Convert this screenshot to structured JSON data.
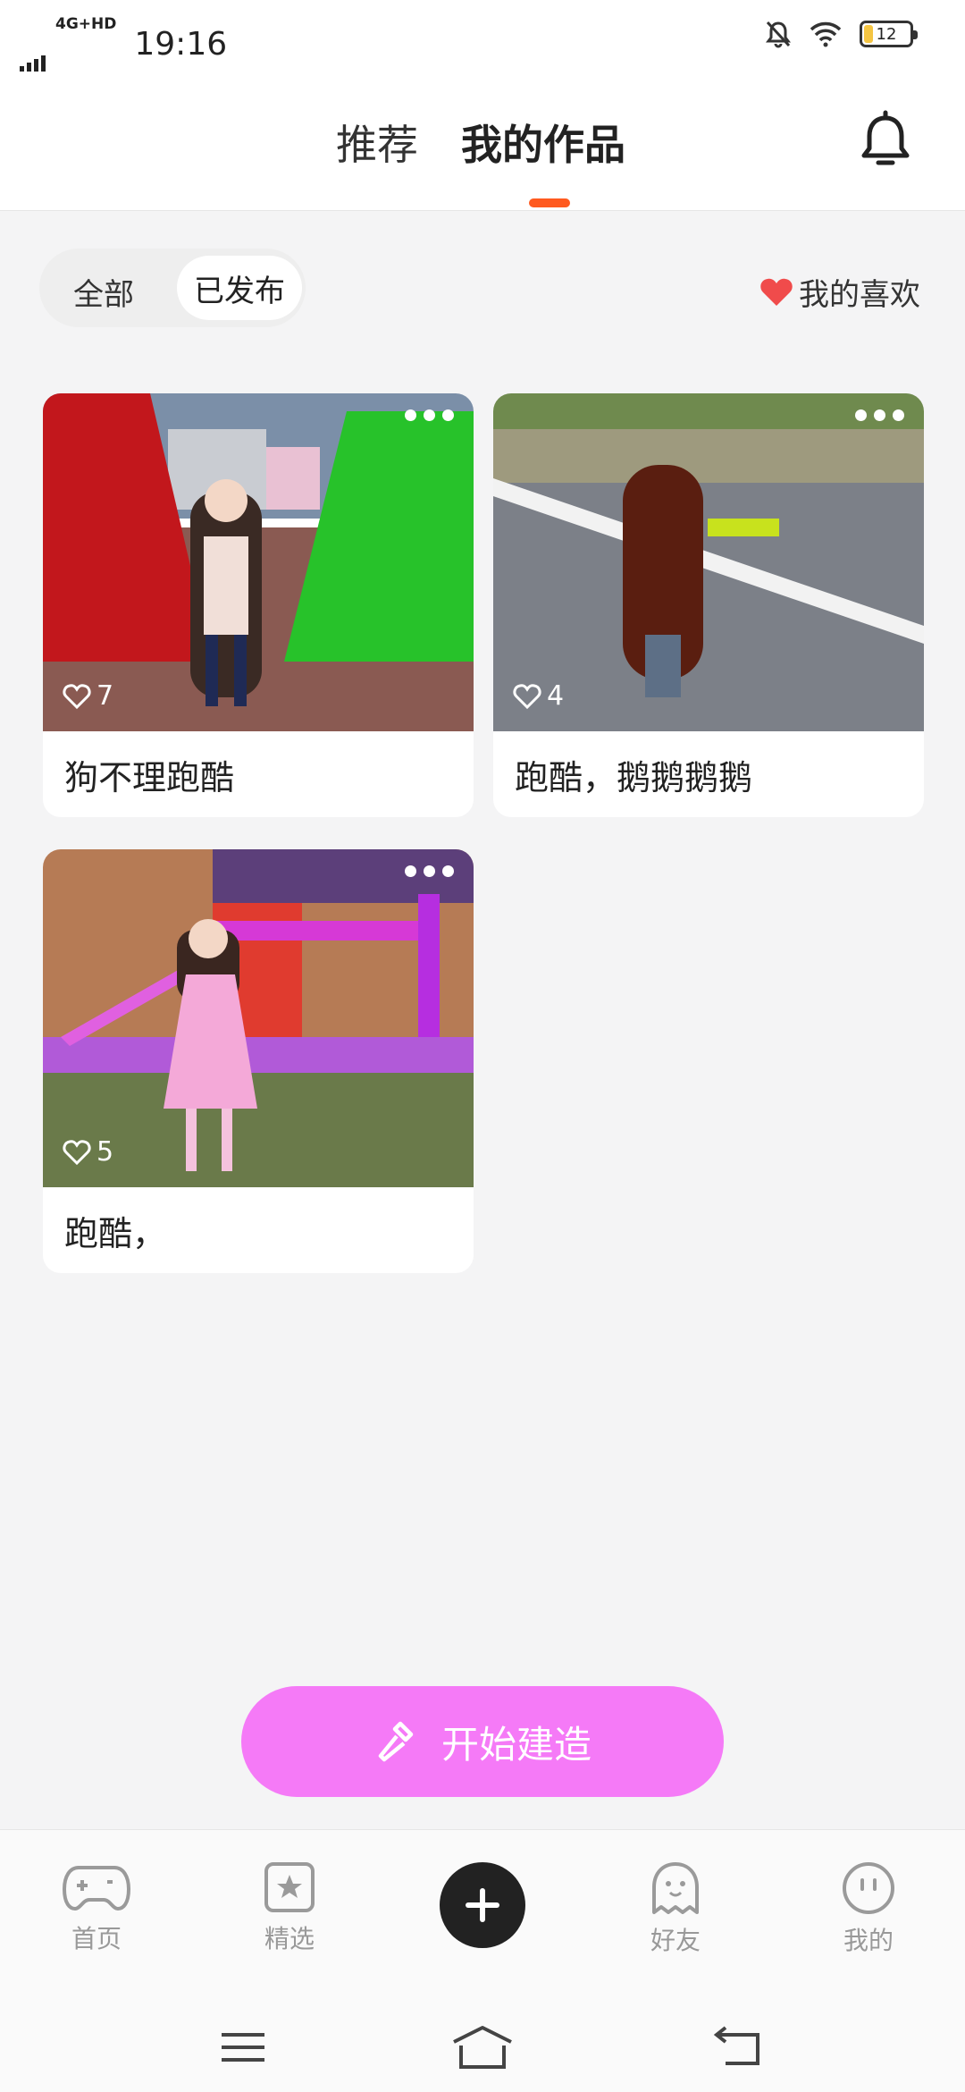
{
  "status": {
    "network": "4G+HD",
    "time": "19:16",
    "battery": "12"
  },
  "topnav": {
    "tabs": [
      {
        "label": "推荐"
      },
      {
        "label": "我的作品"
      }
    ]
  },
  "filter": {
    "all": "全部",
    "published": "已发布",
    "favorites": "我的喜欢"
  },
  "works": [
    {
      "title": "狗不理跑酷",
      "likes": "7"
    },
    {
      "title": "跑酷，鹅鹅鹅鹅",
      "likes": "4"
    },
    {
      "title": "跑酷，",
      "likes": "5"
    }
  ],
  "build_button": "开始建造",
  "bottomnav": [
    {
      "label": "首页",
      "icon": "gamepad-icon"
    },
    {
      "label": "精选",
      "icon": "star-bookmark-icon"
    },
    {
      "label": "",
      "icon": "plus-icon"
    },
    {
      "label": "好友",
      "icon": "ghost-icon"
    },
    {
      "label": "我的",
      "icon": "face-icon"
    }
  ],
  "colors": {
    "accent": "#ff5a1f",
    "build_button": "#f57af7",
    "heart": "#f04b4b"
  }
}
